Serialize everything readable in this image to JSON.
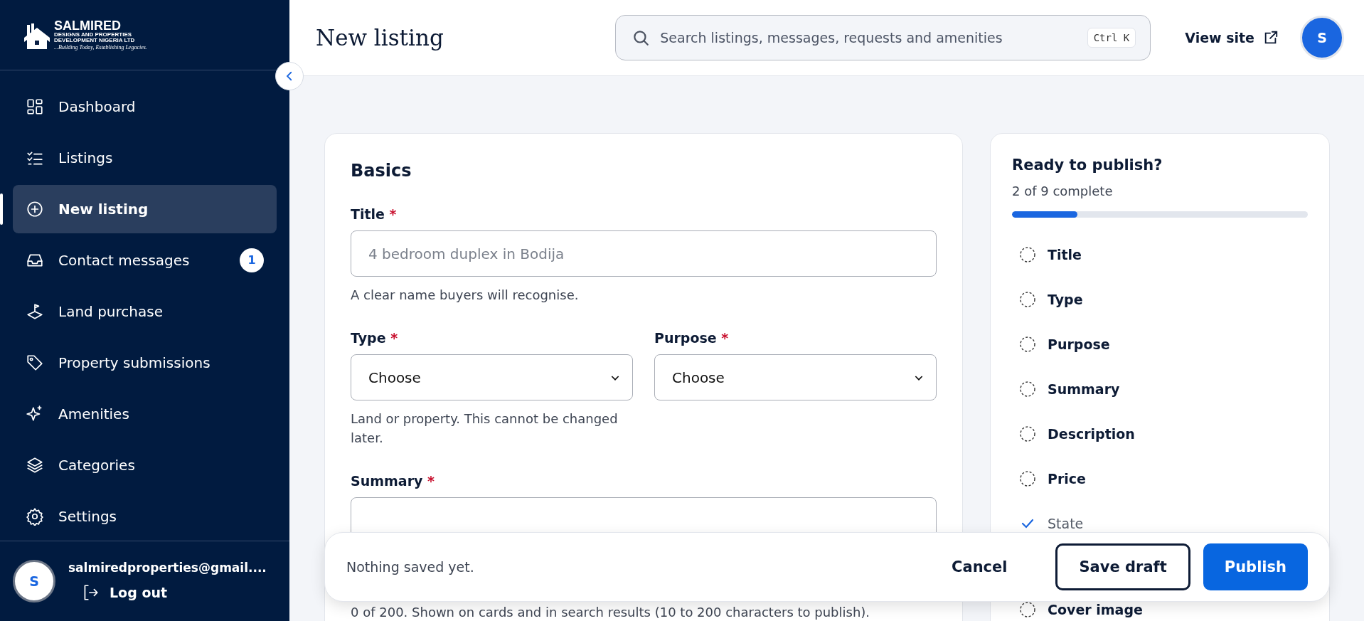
{
  "brand": {
    "name": "SALMIRED",
    "line_1": "DESIGNS AND PROPERTIES",
    "line_2": "DEVELOPMENT NIGERIA LTD",
    "tagline": "...Building Today, Establishing Legacies."
  },
  "sidebar": {
    "items": [
      {
        "kind": "dashboard",
        "label": "Dashboard",
        "selected": false
      },
      {
        "kind": "listings",
        "label": "Listings",
        "selected": false
      },
      {
        "kind": "new",
        "label": "New listing",
        "selected": true
      },
      {
        "kind": "messages",
        "label": "Contact messages",
        "selected": false,
        "badge": "1"
      },
      {
        "kind": "land",
        "label": "Land purchase",
        "selected": false
      },
      {
        "kind": "tag",
        "label": "Property submissions",
        "selected": false
      },
      {
        "kind": "sparkle",
        "label": "Amenities",
        "selected": false
      },
      {
        "kind": "layers",
        "label": "Categories",
        "selected": false
      },
      {
        "kind": "settings",
        "label": "Settings",
        "selected": false
      }
    ],
    "user": {
      "avatar": "S",
      "email": "salmiredproperties@gmail....",
      "logout": "Log out"
    }
  },
  "header": {
    "title": "New listing",
    "search": {
      "placeholder": "Search listings, messages, requests and amenities",
      "shortcut": "Ctrl K"
    },
    "view_site": "View site",
    "avatar": "S"
  },
  "form": {
    "section": "Basics",
    "title_field": {
      "label": "Title",
      "required_mark": "*",
      "placeholder": "4 bedroom duplex in Bodija",
      "hint": "A clear name buyers will recognise."
    },
    "type_field": {
      "label": "Type",
      "required_mark": "*",
      "value": "Choose",
      "hint": "Land or property. This cannot be changed later."
    },
    "purpose_field": {
      "label": "Purpose",
      "required_mark": "*",
      "value": "Choose"
    },
    "summary_field": {
      "label": "Summary",
      "required_mark": "*",
      "hint": "0 of 200. Shown on cards and in search results (10 to 200 characters to publish)."
    }
  },
  "checklist": {
    "title": "Ready to publish?",
    "progress_text": "2 of 9 complete",
    "level": 0.22,
    "items": [
      {
        "label": "Title",
        "done": false
      },
      {
        "label": "Type",
        "done": false
      },
      {
        "label": "Purpose",
        "done": false
      },
      {
        "label": "Summary",
        "done": false
      },
      {
        "label": "Description",
        "done": false
      },
      {
        "label": "Price",
        "done": false
      },
      {
        "label": "State",
        "done": true
      },
      {
        "label": "Cover image",
        "done": false
      }
    ]
  },
  "save_bar": {
    "status": "Nothing saved yet.",
    "buttons": [
      {
        "kind": "text",
        "label": "Cancel"
      },
      {
        "kind": "outline",
        "label": "Save draft"
      },
      {
        "kind": "primary",
        "label": "Publish"
      }
    ]
  }
}
